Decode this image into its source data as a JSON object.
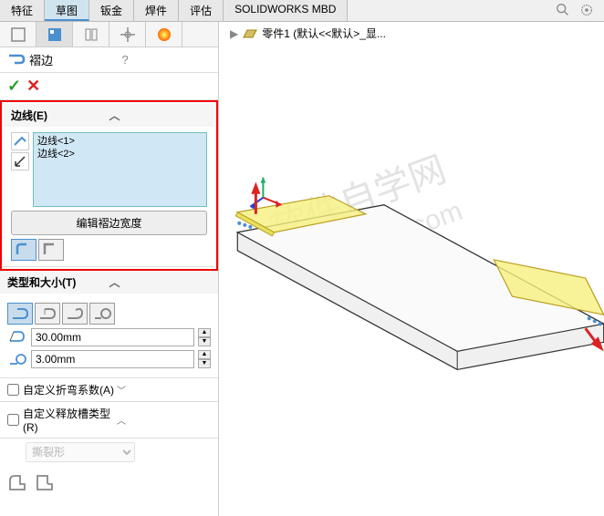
{
  "tabs": [
    "特征",
    "草图",
    "钣金",
    "焊件",
    "评估",
    "SOLIDWORKS MBD"
  ],
  "active_tab": 1,
  "feature": {
    "name": "褶边",
    "help": "?"
  },
  "edge_section": {
    "title": "边线(E)",
    "items": [
      "边线<1>",
      "边线<2>"
    ],
    "edit_width_btn": "编辑褶边宽度"
  },
  "type_section": {
    "title": "类型和大小(T)",
    "length_value": "30.00mm",
    "radius_value": "3.00mm"
  },
  "custom_bend": {
    "label": "自定义折弯系数(A)"
  },
  "custom_relief": {
    "label": "自定义释放槽类型(R)",
    "select_value": "撕裂形"
  },
  "breadcrumb": {
    "part": "零件1 (默认<<默认>_显..."
  }
}
